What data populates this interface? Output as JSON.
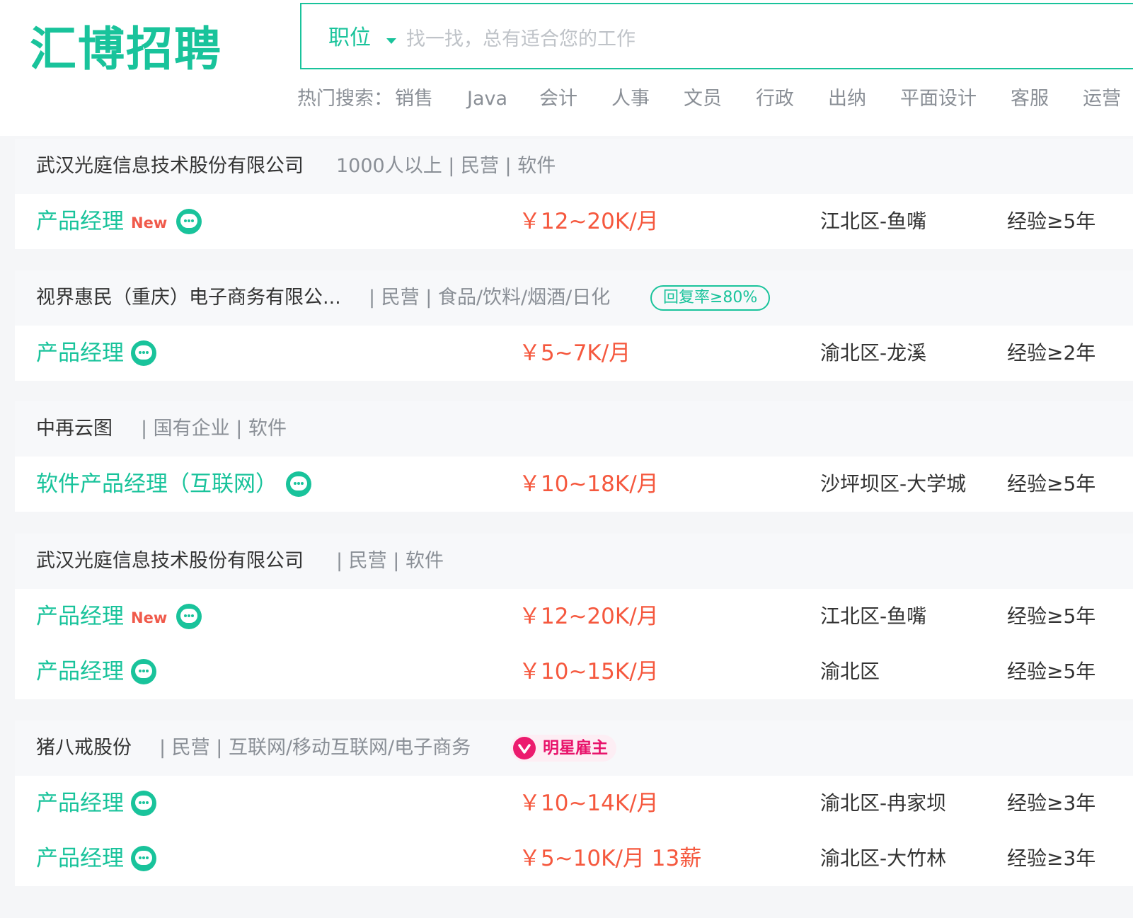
{
  "header": {
    "logo": "汇博招聘",
    "search": {
      "type": "职位",
      "placeholder": "找一找，总有适合您的工作"
    },
    "hot_label": "热门搜索：",
    "hot_items": [
      "销售",
      "Java",
      "会计",
      "人事",
      "文员",
      "行政",
      "出纳",
      "平面设计",
      "客服",
      "运营"
    ]
  },
  "companies": [
    {
      "name": "武汉光庭信息技术股份有限公司",
      "meta": "1000人以上 | 民营 | 软件",
      "jobs": [
        {
          "title": "产品经理",
          "new": "New",
          "salary": "￥12~20K/月",
          "location": "江北区-鱼嘴",
          "exp": "经验≥5年"
        }
      ]
    },
    {
      "name": "视界惠民（重庆）电子商务有限公...",
      "meta": "| 民营 | 食品/饮料/烟酒/日化",
      "badge": "回复率≥80%",
      "jobs": [
        {
          "title": "产品经理",
          "salary": "￥5~7K/月",
          "location": "渝北区-龙溪",
          "exp": "经验≥2年"
        }
      ]
    },
    {
      "name": "中再云图",
      "meta": "| 国有企业 | 软件",
      "jobs": [
        {
          "title": "软件产品经理（互联网）",
          "salary": "￥10~18K/月",
          "location": "沙坪坝区-大学城",
          "exp": "经验≥5年"
        }
      ]
    },
    {
      "name": "武汉光庭信息技术股份有限公司",
      "meta": "| 民营 | 软件",
      "jobs": [
        {
          "title": "产品经理",
          "new": "New",
          "salary": "￥12~20K/月",
          "location": "江北区-鱼嘴",
          "exp": "经验≥5年"
        },
        {
          "title": "产品经理",
          "salary": "￥10~15K/月",
          "location": "渝北区",
          "exp": "经验≥5年"
        }
      ]
    },
    {
      "name": "猪八戒股份",
      "meta": "| 民营 | 互联网/移动互联网/电子商务",
      "star_badge": "明星雇主",
      "jobs": [
        {
          "title": "产品经理",
          "salary": "￥10~14K/月",
          "location": "渝北区-冉家坝",
          "exp": "经验≥3年"
        },
        {
          "title": "产品经理",
          "salary": "￥5~10K/月 13薪",
          "location": "渝北区-大竹林",
          "exp": "经验≥3年"
        }
      ]
    }
  ],
  "colors": {
    "brand": "#19c39b",
    "salary": "#f5583e",
    "new_tag": "#f05a4b",
    "star_badge": "#e8136b"
  },
  "icons": {
    "chat": "chat-bubble-icon",
    "dropdown": "caret-down-icon",
    "star_employer": "heart-badge-icon"
  }
}
